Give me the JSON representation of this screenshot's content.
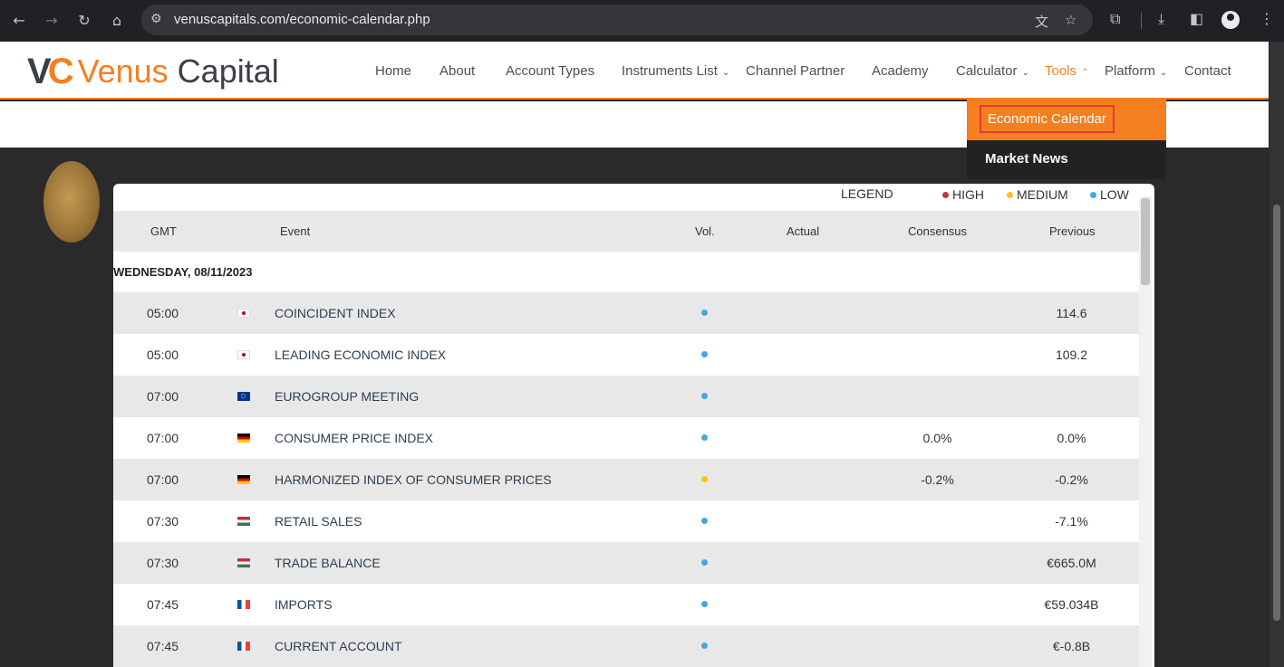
{
  "browser": {
    "url": "venuscapitals.com/economic-calendar.php",
    "icons": [
      "back-icon",
      "forward-icon",
      "reload-icon",
      "home-icon",
      "tune-icon",
      "translate-icon",
      "star-icon",
      "extensions-icon",
      "download-icon",
      "sidepanel-icon",
      "profile-icon",
      "menu-icon"
    ]
  },
  "site": {
    "logo_mark_left": "V",
    "logo_mark_right": "C",
    "logo_name1": "Venus",
    "logo_name2": "Capital",
    "accent_color": "#f47f20",
    "nav": [
      {
        "label": "Home"
      },
      {
        "label": "About"
      },
      {
        "label": "Account Types"
      },
      {
        "label": "Instruments List",
        "chevron": "⌄"
      },
      {
        "label": "Channel Partner"
      },
      {
        "label": "Academy"
      },
      {
        "label": "Calculator",
        "chevron": "⌄"
      },
      {
        "label": "Tools",
        "chevron": "⌃"
      },
      {
        "label": "Platform",
        "chevron": "⌄"
      },
      {
        "label": "Contact"
      }
    ],
    "dropdown": {
      "items": [
        "Economic Calendar",
        "Market News"
      ]
    }
  },
  "calendar": {
    "legend": {
      "label": "LEGEND",
      "high": "HIGH",
      "medium": "MEDIUM",
      "low": "LOW",
      "colors": {
        "high": "#c0392b",
        "medium": "#f5c518",
        "low": "#3fa9e0"
      }
    },
    "headers": {
      "gmt": "GMT",
      "event": "Event",
      "vol": "Vol.",
      "actual": "Actual",
      "consensus": "Consensus",
      "previous": "Previous"
    },
    "day": "WEDNESDAY, 08/11/2023",
    "rows": [
      {
        "time": "05:00",
        "flag": "JP",
        "event": "COINCIDENT INDEX",
        "vol": "low",
        "actual": "",
        "consensus": "",
        "previous": "114.6"
      },
      {
        "time": "05:00",
        "flag": "JP",
        "event": "LEADING ECONOMIC INDEX",
        "vol": "low",
        "actual": "",
        "consensus": "",
        "previous": "109.2"
      },
      {
        "time": "07:00",
        "flag": "EU",
        "event": "EUROGROUP MEETING",
        "vol": "low",
        "actual": "",
        "consensus": "",
        "previous": ""
      },
      {
        "time": "07:00",
        "flag": "DE",
        "event": "CONSUMER PRICE INDEX",
        "vol": "low",
        "actual": "",
        "consensus": "0.0%",
        "previous": "0.0%"
      },
      {
        "time": "07:00",
        "flag": "DE",
        "event": "HARMONIZED INDEX OF CONSUMER PRICES",
        "vol": "medium",
        "actual": "",
        "consensus": "-0.2%",
        "previous": "-0.2%"
      },
      {
        "time": "07:30",
        "flag": "HU",
        "event": "RETAIL SALES",
        "vol": "low",
        "actual": "",
        "consensus": "",
        "previous": "-7.1%"
      },
      {
        "time": "07:30",
        "flag": "HU",
        "event": "TRADE BALANCE",
        "vol": "low",
        "actual": "",
        "consensus": "",
        "previous": "€665.0M"
      },
      {
        "time": "07:45",
        "flag": "FR",
        "event": "IMPORTS",
        "vol": "low",
        "actual": "",
        "consensus": "",
        "previous": "€59.034B"
      },
      {
        "time": "07:45",
        "flag": "FR",
        "event": "CURRENT ACCOUNT",
        "vol": "low",
        "actual": "",
        "consensus": "",
        "previous": "€-0.8B"
      }
    ]
  }
}
